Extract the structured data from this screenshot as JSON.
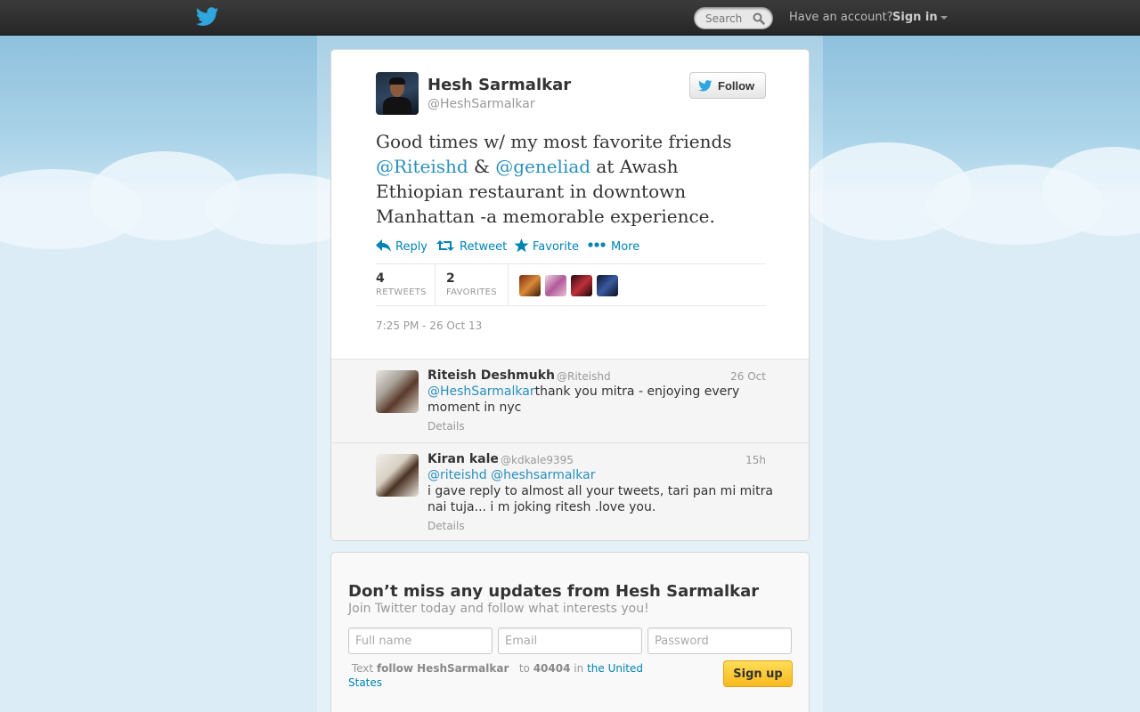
{
  "topbar": {
    "search_placeholder": "Search",
    "have_account": "Have an account?",
    "sign_in": "Sign in"
  },
  "tweet": {
    "author_name": "Hesh Sarmalkar",
    "author_handle": "@HeshSarmalkar",
    "follow_label": "Follow",
    "text_part1": "Good times w/ my most favorite friends ",
    "mention1": "@Riteishd",
    "text_part2": " & ",
    "mention2": "@geneliad",
    "text_part3": " at Awash Ethiopian restaurant in  downtown Manhattan -a memorable experience.",
    "actions": {
      "reply": "Reply",
      "retweet": "Retweet",
      "favorite": "Favorite",
      "more": "More"
    },
    "retweets_count": "4",
    "retweets_label": "RETWEETS",
    "favorites_count": "2",
    "favorites_label": "FAVORITES",
    "timestamp": "7:25 PM - 26 Oct 13"
  },
  "replies": [
    {
      "name": "Riteish Deshmukh",
      "handle": "@Riteishd",
      "time": "26 Oct",
      "mention": "@HeshSarmalkar",
      "text": "thank you mitra - enjoying every moment in nyc",
      "details": "Details"
    },
    {
      "name": "Kiran kale",
      "handle": "@kdkale9395",
      "time": "15h",
      "mention1": "@riteishd",
      "mention2": "@heshsarmalkar",
      "text": "i gave reply to almost all your tweets, tari pan mi mitra nai tuja...  i m joking ritesh .love you.",
      "details": "Details"
    }
  ],
  "signup": {
    "title": "Don’t miss any updates from Hesh Sarmalkar",
    "subtitle": "Join Twitter today and follow what interests you!",
    "fullname_placeholder": "Full name",
    "email_placeholder": "Email",
    "password_placeholder": "Password",
    "sms_text": "Text",
    "sms_command": "follow HeshSarmalkar",
    "sms_to": "to",
    "sms_number": "40404",
    "sms_in": "in",
    "sms_country": "the United States",
    "signup_label": "Sign up"
  },
  "colors": {
    "link": "#0084b4",
    "mention": "#2a8fbd",
    "signup_button": "#f8b91c",
    "topbar": "#2e2e2e",
    "background": "#c0deed"
  }
}
